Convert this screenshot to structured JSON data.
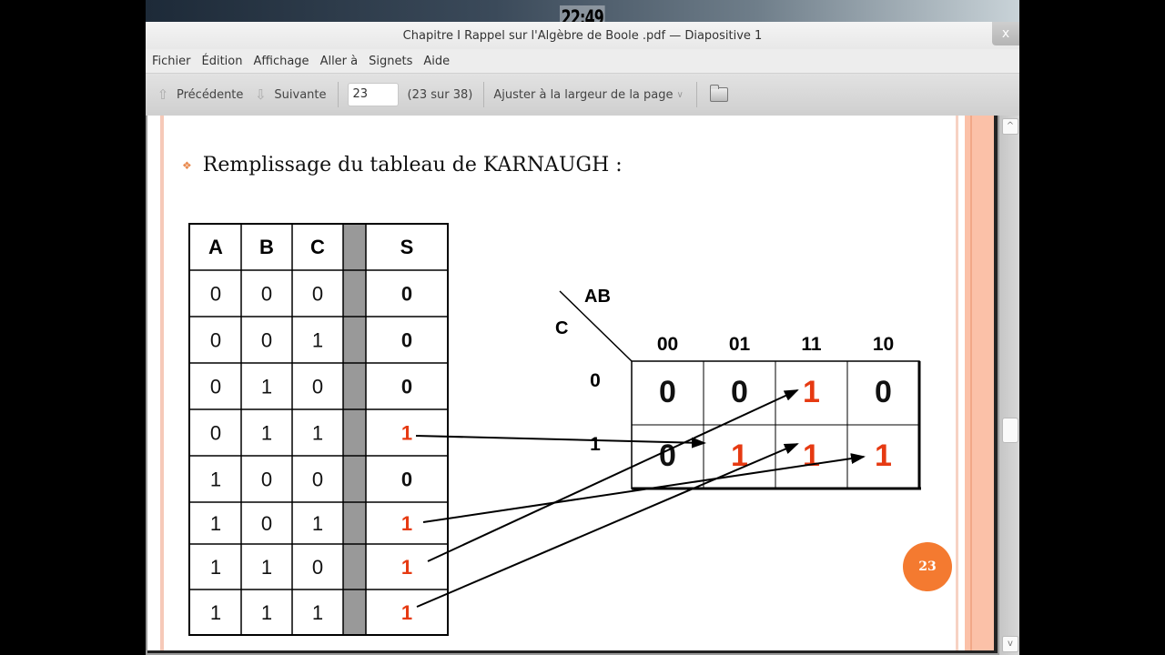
{
  "clock": "22:49",
  "window": {
    "title": "Chapitre I Rappel sur l'Algèbre de Boole .pdf — Diapositive 1",
    "close_label": "x"
  },
  "menu": [
    "Fichier",
    "Édition",
    "Affichage",
    "Aller à",
    "Signets",
    "Aide"
  ],
  "toolbar": {
    "prev_label": "Précédente",
    "next_label": "Suivante",
    "page_value": "23",
    "page_count": "(23 sur 38)",
    "zoom_mode": "Ajuster à la largeur de la page"
  },
  "slide": {
    "heading": "Remplissage du tableau de KARNAUGH :",
    "page_number": "23",
    "accent_color": "#f47a30",
    "one_color": "#e63a12",
    "truth_table": {
      "headers": [
        "A",
        "B",
        "C",
        "S"
      ],
      "rows": [
        [
          "0",
          "0",
          "0",
          "0"
        ],
        [
          "0",
          "0",
          "1",
          "0"
        ],
        [
          "0",
          "1",
          "0",
          "0"
        ],
        [
          "0",
          "1",
          "1",
          "1"
        ],
        [
          "1",
          "0",
          "0",
          "0"
        ],
        [
          "1",
          "0",
          "1",
          "1"
        ],
        [
          "1",
          "1",
          "0",
          "1"
        ],
        [
          "1",
          "1",
          "1",
          "1"
        ]
      ]
    },
    "kmap": {
      "row_var": "C",
      "col_var": "AB",
      "col_labels": [
        "00",
        "01",
        "11",
        "10"
      ],
      "row_labels": [
        "0",
        "1"
      ],
      "cells": [
        [
          "0",
          "0",
          "1",
          "0"
        ],
        [
          "0",
          "1",
          "1",
          "1"
        ]
      ]
    },
    "arrows": [
      {
        "from_row": 3,
        "to": [
          1,
          1
        ]
      },
      {
        "from_row": 5,
        "to": [
          1,
          3
        ]
      },
      {
        "from_row": 6,
        "to": [
          0,
          2
        ]
      },
      {
        "from_row": 7,
        "to": [
          1,
          2
        ]
      }
    ]
  }
}
